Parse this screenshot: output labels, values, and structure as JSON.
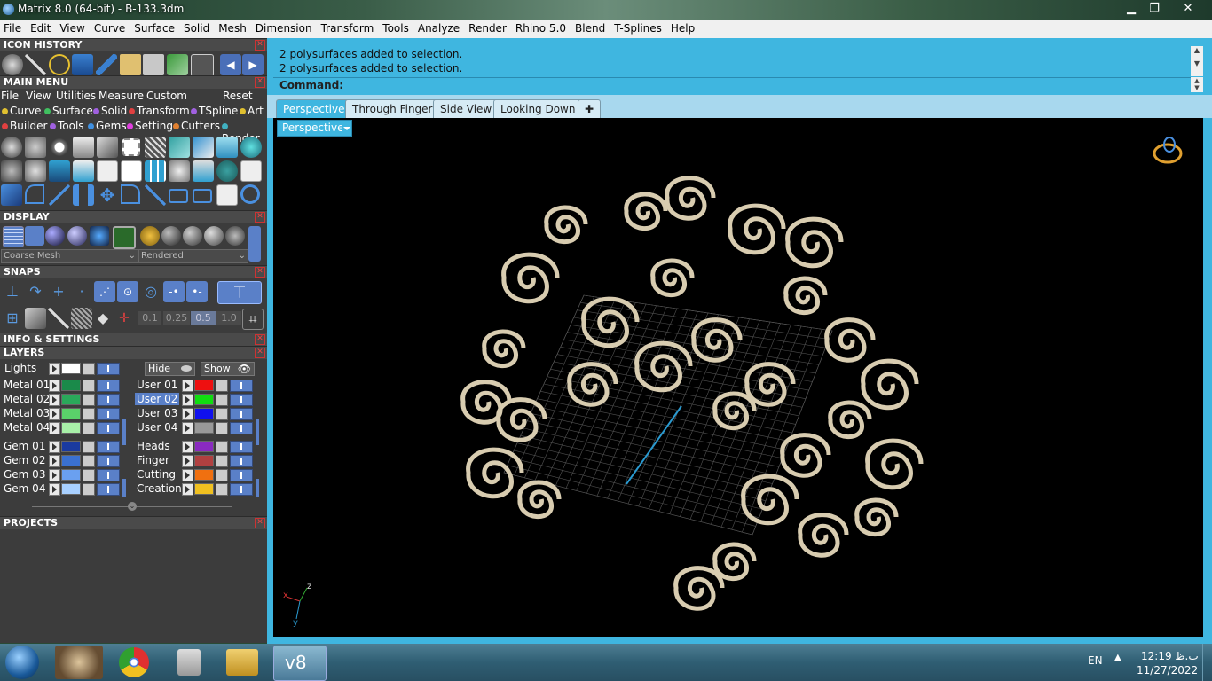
{
  "window": {
    "title": "Matrix 8.0 (64-bit) - B-133.3dm"
  },
  "menubar": [
    "File",
    "Edit",
    "View",
    "Curve",
    "Surface",
    "Solid",
    "Mesh",
    "Dimension",
    "Transform",
    "Tools",
    "Analyze",
    "Render",
    "Rhino 5.0",
    "Blend",
    "T-Splines",
    "Help"
  ],
  "panels": {
    "icon_history": "ICON HISTORY",
    "main_menu": "MAIN MENU",
    "display": "DISPLAY",
    "snaps": "SNAPS",
    "info_settings": "INFO & SETTINGS",
    "layers": "LAYERS",
    "projects": "PROJECTS"
  },
  "main_menu_bar": [
    "File",
    "View",
    "Utilities",
    "Measure",
    "Custom"
  ],
  "main_menu_reset": "Reset",
  "categories_row1": [
    {
      "label": "Curve",
      "color": "#e0c030"
    },
    {
      "label": "Surface",
      "color": "#40c060"
    },
    {
      "label": "Solid",
      "color": "#a060e0"
    },
    {
      "label": "Transform",
      "color": "#e04040"
    },
    {
      "label": "TSpline",
      "color": "#a060e0"
    },
    {
      "label": "Art",
      "color": "#e0c030"
    }
  ],
  "categories_row2": [
    {
      "label": "Builder",
      "color": "#e04040"
    },
    {
      "label": "Tools",
      "color": "#a060e0"
    },
    {
      "label": "Gems",
      "color": "#4090e0"
    },
    {
      "label": "Setting",
      "color": "#e040e0"
    },
    {
      "label": "Cutters",
      "color": "#e08030"
    },
    {
      "label": "Render",
      "color": "#40b0c0"
    }
  ],
  "display": {
    "mesh_select": "Coarse Mesh",
    "render_select": "Rendered"
  },
  "snaps": {
    "values": [
      "0.1",
      "0.25",
      "0.5",
      "1.0"
    ]
  },
  "layers": {
    "lights": "Lights",
    "hide": "Hide",
    "show": "Show",
    "left_group1": [
      {
        "name": "Metal 01",
        "color": "#1a8a4a"
      },
      {
        "name": "Metal 02",
        "color": "#2aa85a"
      },
      {
        "name": "Metal 03",
        "color": "#5ad06a"
      },
      {
        "name": "Metal 04",
        "color": "#a8f0a8"
      }
    ],
    "left_group2": [
      {
        "name": "Gem 01",
        "color": "#1a3aa0"
      },
      {
        "name": "Gem 02",
        "color": "#3a70d0"
      },
      {
        "name": "Gem 03",
        "color": "#6aa0f0"
      },
      {
        "name": "Gem 04",
        "color": "#a8d0ff"
      }
    ],
    "right_group1": [
      {
        "name": "User 01",
        "color": "#ee1010"
      },
      {
        "name": "User 02",
        "color": "#10dd10"
      },
      {
        "name": "User 03",
        "color": "#1010ee"
      },
      {
        "name": "User 04",
        "color": "#999999"
      }
    ],
    "right_group2": [
      {
        "name": "Heads",
        "color": "#8a2ac0"
      },
      {
        "name": "Finger",
        "color": "#b04040"
      },
      {
        "name": "Cutting",
        "color": "#f07010"
      },
      {
        "name": "Creation",
        "color": "#f0c020"
      }
    ]
  },
  "command": {
    "history": [
      "2 polysurfaces added to selection.",
      "2 polysurfaces added to selection."
    ],
    "prompt": "Command:"
  },
  "viewport_tabs": [
    "Perspective",
    "Through Finger",
    "Side View",
    "Looking Down"
  ],
  "viewport": {
    "label": "Perspective",
    "axis_x": "x",
    "axis_z": "z",
    "axis_y": "y"
  },
  "taskbar": {
    "lang": "EN",
    "time": "12:19 ب.ظ",
    "date": "11/27/2022",
    "app_label": "v8"
  }
}
